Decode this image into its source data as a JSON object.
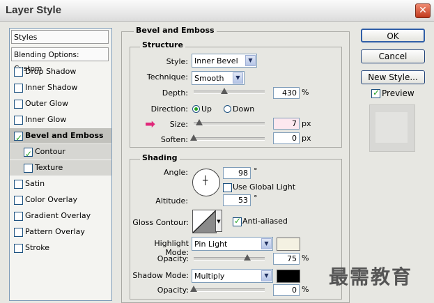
{
  "window": {
    "title": "Layer Style",
    "close_glyph": "✕"
  },
  "left_panel": {
    "styles_label": "Styles",
    "blending_label": "Blending Options: Custom",
    "items": [
      {
        "label": "Drop Shadow",
        "checked": false
      },
      {
        "label": "Inner Shadow",
        "checked": false
      },
      {
        "label": "Outer Glow",
        "checked": false
      },
      {
        "label": "Inner Glow",
        "checked": false
      },
      {
        "label": "Bevel and Emboss",
        "checked": true,
        "selected": true
      },
      {
        "label": "Contour",
        "checked": true,
        "sub": true
      },
      {
        "label": "Texture",
        "checked": false,
        "sub": true
      },
      {
        "label": "Satin",
        "checked": false
      },
      {
        "label": "Color Overlay",
        "checked": false
      },
      {
        "label": "Gradient Overlay",
        "checked": false
      },
      {
        "label": "Pattern Overlay",
        "checked": false
      },
      {
        "label": "Stroke",
        "checked": false
      }
    ]
  },
  "bevel": {
    "group_label": "Bevel and Emboss",
    "structure": {
      "label": "Structure",
      "style_label": "Style:",
      "style_value": "Inner Bevel",
      "technique_label": "Technique:",
      "technique_value": "Smooth",
      "depth_label": "Depth:",
      "depth_value": "430",
      "depth_unit": "%",
      "direction_label": "Direction:",
      "direction_up": "Up",
      "direction_down": "Down",
      "size_label": "Size:",
      "size_value": "7",
      "size_unit": "px",
      "soften_label": "Soften:",
      "soften_value": "0",
      "soften_unit": "px"
    },
    "shading": {
      "label": "Shading",
      "angle_label": "Angle:",
      "angle_value": "98",
      "degree": "°",
      "global_light_label": "Use Global Light",
      "altitude_label": "Altitude:",
      "altitude_value": "53",
      "gloss_label": "Gloss Contour:",
      "anti_aliased_label": "Anti-aliased",
      "highlight_label": "Highlight Mode:",
      "highlight_value": "Pin Light",
      "highlight_color": "#f4f1e2",
      "highlight_opacity_label": "Opacity:",
      "highlight_opacity_value": "75",
      "shadow_label": "Shadow Mode:",
      "shadow_value": "Multiply",
      "shadow_color": "#000000",
      "shadow_opacity_label": "Opacity:",
      "shadow_opacity_value": "0",
      "percent": "%"
    }
  },
  "buttons": {
    "ok": "OK",
    "cancel": "Cancel",
    "new_style": "New Style...",
    "preview": "Preview"
  },
  "watermark": "最需教育",
  "colors": {
    "arrow": "#e0287a",
    "check": "#21a121"
  }
}
